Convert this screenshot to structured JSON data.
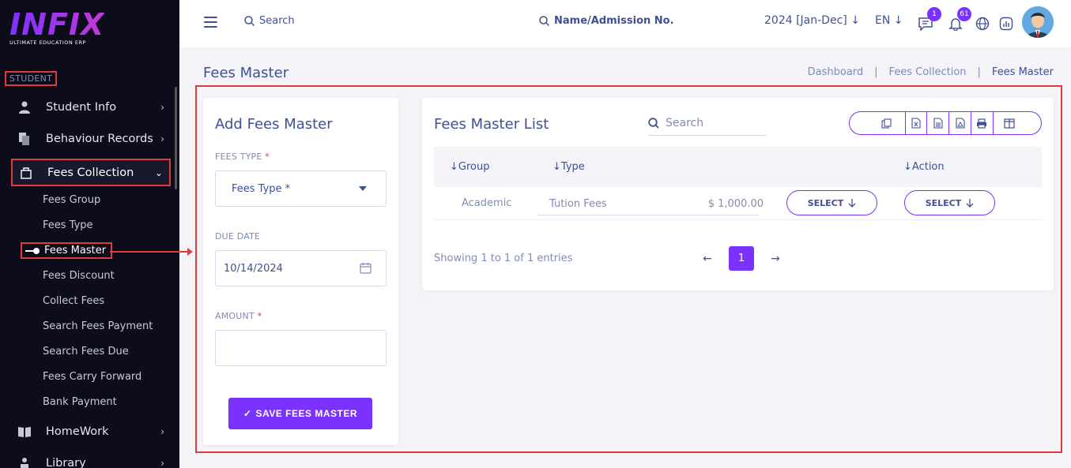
{
  "sidebar": {
    "logo_text": "INFIX",
    "logo_subtitle": "ULTIMATE EDUCATION ERP",
    "section_label": "STUDENT",
    "items": [
      {
        "label": "Student Info",
        "icon": "user-icon"
      },
      {
        "label": "Behaviour Records",
        "icon": "files-icon"
      },
      {
        "label": "Fees Collection",
        "icon": "fees-icon"
      },
      {
        "label": "HomeWork",
        "icon": "book-icon"
      },
      {
        "label": "Library",
        "icon": "library-icon"
      }
    ],
    "sub_items": [
      "Fees Group",
      "Fees Type",
      "Fees Master",
      "Fees Discount",
      "Collect Fees",
      "Search Fees Payment",
      "Search Fees Due",
      "Fees Carry Forward",
      "Bank Payment"
    ]
  },
  "header": {
    "search_label": "Search",
    "student_search_label": "Name/Admission No.",
    "year": "2024 [Jan-Dec]",
    "lang": "EN",
    "chat_badge": "1",
    "notif_badge": "61"
  },
  "page": {
    "title": "Fees Master",
    "breadcrumb": [
      "Dashboard",
      "Fees Collection",
      "Fees Master"
    ]
  },
  "form": {
    "title": "Add Fees Master",
    "fees_type_label": "FEES TYPE",
    "fees_type_placeholder": "Fees Type *",
    "due_date_label": "DUE DATE",
    "due_date_value": "10/14/2024",
    "amount_label": "AMOUNT",
    "amount_value": "",
    "required_mark": "*",
    "save_label": "SAVE FEES MASTER"
  },
  "list": {
    "title": "Fees Master List",
    "search_placeholder": "Search",
    "columns": [
      "Group",
      "Type",
      "Action"
    ],
    "rows": [
      {
        "group": "Academic",
        "type": "Tution Fees",
        "amount": "$ 1,000.00",
        "select1": "SELECT",
        "select2": "SELECT"
      }
    ],
    "showing": "Showing 1 to 1 of 1 entries",
    "page": "1"
  },
  "colors": {
    "accent": "#7c32ff",
    "highlight": "#e03a3a",
    "sidebar_bg": "#0c0c1b"
  }
}
